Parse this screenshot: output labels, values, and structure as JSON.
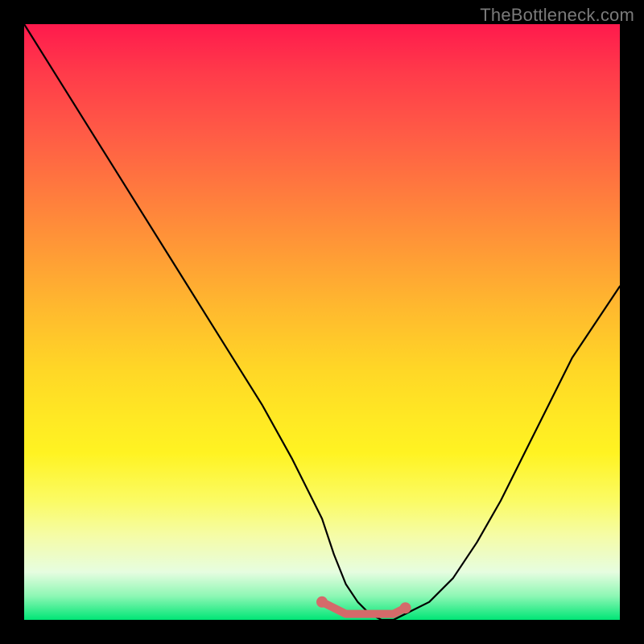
{
  "watermark": "TheBottleneck.com",
  "chart_data": {
    "type": "line",
    "title": "",
    "xlabel": "",
    "ylabel": "",
    "xlim": [
      0,
      100
    ],
    "ylim": [
      0,
      100
    ],
    "grid": false,
    "legend": false,
    "series": [
      {
        "name": "main-curve",
        "color": "#000000",
        "x": [
          0,
          5,
          10,
          15,
          20,
          25,
          30,
          35,
          40,
          45,
          50,
          52,
          54,
          56,
          58,
          60,
          62,
          64,
          68,
          72,
          76,
          80,
          84,
          88,
          92,
          96,
          100
        ],
        "y": [
          100,
          92,
          84,
          76,
          68,
          60,
          52,
          44,
          36,
          27,
          17,
          11,
          6,
          3,
          1,
          0,
          0,
          1,
          3,
          7,
          13,
          20,
          28,
          36,
          44,
          50,
          56
        ]
      },
      {
        "name": "zero-bottleneck-band",
        "color": "#d46a6a",
        "x": [
          50,
          52,
          54,
          56,
          58,
          60,
          62,
          64
        ],
        "y": [
          3,
          2,
          1,
          1,
          1,
          1,
          1,
          2
        ]
      }
    ],
    "gradient_stops": [
      {
        "pct": 0,
        "color": "#ff1a4d"
      },
      {
        "pct": 50,
        "color": "#ffd726"
      },
      {
        "pct": 85,
        "color": "#f5fca8"
      },
      {
        "pct": 100,
        "color": "#00e676"
      }
    ]
  }
}
